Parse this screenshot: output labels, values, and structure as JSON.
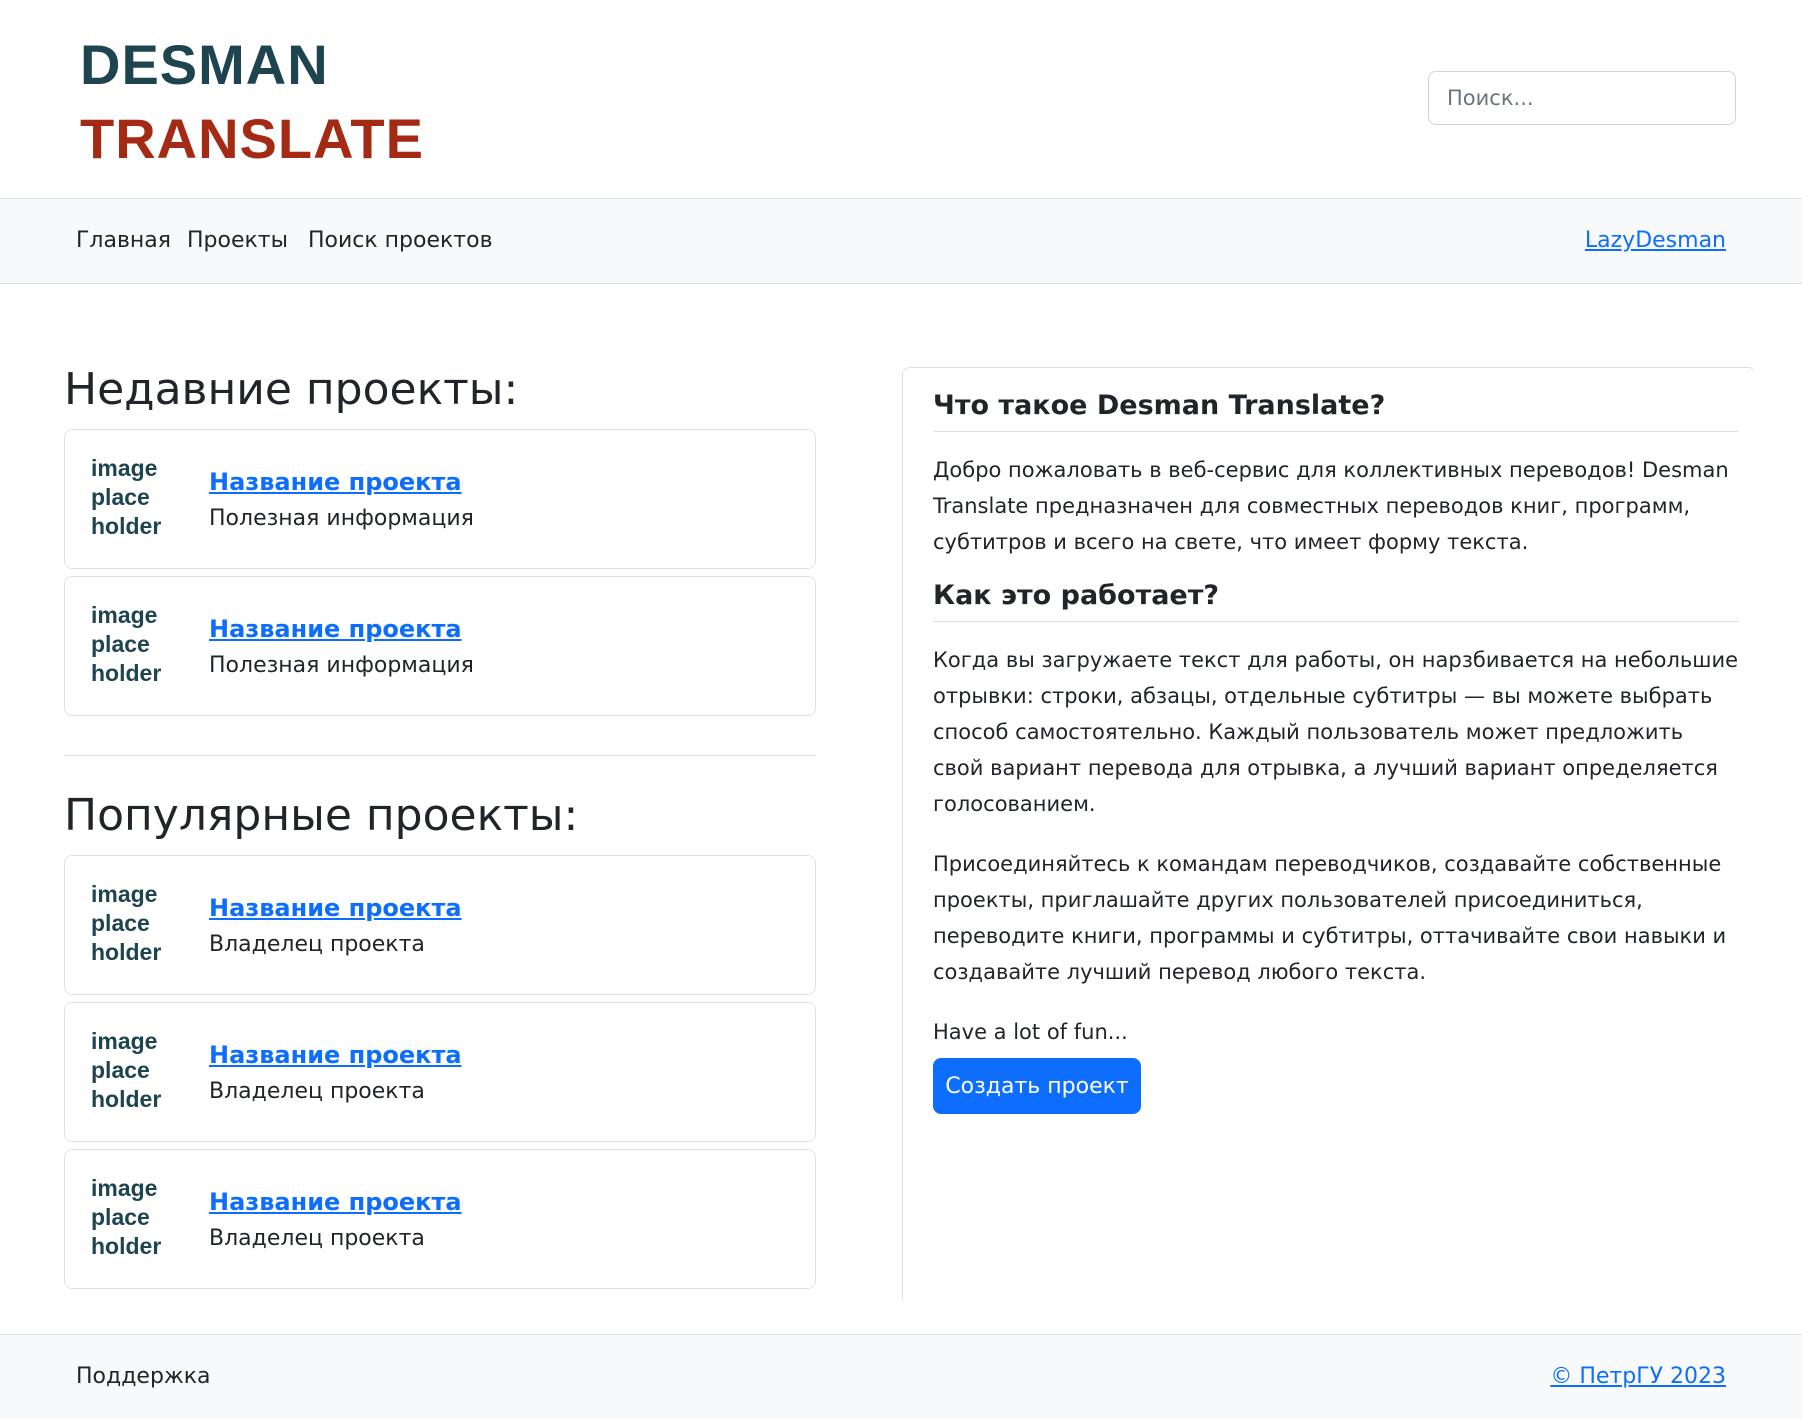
{
  "header": {
    "logo_line1": "DESMAN",
    "logo_line2": "TRANSLATE",
    "search_placeholder": "Поиск..."
  },
  "nav": {
    "items": [
      "Главная",
      "Проекты",
      "Поиск проектов"
    ],
    "user": "LazyDesman"
  },
  "recent": {
    "title": "Недавние проекты:",
    "cards": [
      {
        "placeholder": [
          "image",
          "place",
          "holder"
        ],
        "name": "Название проекта",
        "info": "Полезная информация"
      },
      {
        "placeholder": [
          "image",
          "place",
          "holder"
        ],
        "name": "Название проекта",
        "info": "Полезная информация"
      }
    ]
  },
  "popular": {
    "title": "Популярные проекты:",
    "cards": [
      {
        "placeholder": [
          "image",
          "place",
          "holder"
        ],
        "name": "Название проекта",
        "info": "Владелец проекта"
      },
      {
        "placeholder": [
          "image",
          "place",
          "holder"
        ],
        "name": "Название проекта",
        "info": "Владелец проекта"
      },
      {
        "placeholder": [
          "image",
          "place",
          "holder"
        ],
        "name": "Название проекта",
        "info": "Владелец проекта"
      }
    ]
  },
  "about": {
    "heading1": "Что такое Desman Translate?",
    "para1": "Добро пожаловать в веб-сервис для коллективных переводов! Desman Translate предназначен для совместных переводов книг, программ, субтитров и всего на свете, что имеет форму текста.",
    "heading2": "Как это работает?",
    "para2": "Когда вы загружаете текст для работы, он нарзбивается на небольшие отрывки: строки, абзацы, отдельные субтитры — вы можете выбрать способ самостоятельно. Каждый пользователь может предложить свой вариант перевода для отрывка, а лучший вариант определяется голосованием.",
    "para3": "Присоединяйтесь к командам переводчиков, создавайте собственные проекты, приглашайте других пользователей присоединиться, переводите книги, программы и субтитры, оттачивайте свои навыки и создавайте лучший перевод любого текста.",
    "para4": "Have a lot of fun...",
    "create_button": "Создать проект"
  },
  "footer": {
    "support": "Поддержка",
    "copyright": "© ПетрГУ 2023"
  },
  "colors": {
    "logo_dark": "#1e4450",
    "logo_red": "#a52a14",
    "link": "#0d6efd",
    "button": "#0d6efd",
    "bar_bg": "#f8f9fa"
  }
}
